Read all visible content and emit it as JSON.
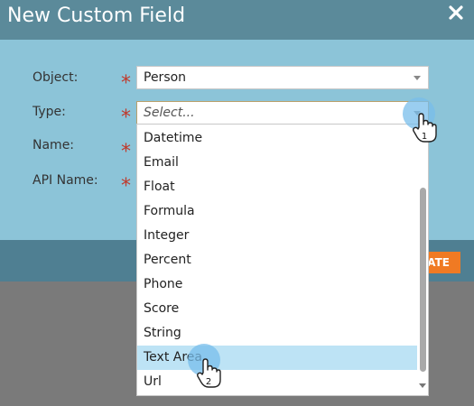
{
  "dialog": {
    "title": "New Custom Field",
    "create_button_label": "ATE"
  },
  "fields": {
    "object_label": "Object:",
    "type_label": "Type:",
    "name_label": "Name:",
    "api_name_label": "API Name:",
    "required_marker": "*",
    "object_value": "Person",
    "type_placeholder": "Select..."
  },
  "dropdown": {
    "options": [
      "Datetime",
      "Email",
      "Float",
      "Formula",
      "Integer",
      "Percent",
      "Phone",
      "Score",
      "String",
      "Text Area",
      "Url"
    ],
    "highlighted": "Text Area"
  },
  "annotations": {
    "step_1": "1",
    "step_2": "2"
  },
  "colors": {
    "title_bar": "#5b8a9a",
    "dialog_body": "#8cc4d8",
    "footer": "#4f7f92",
    "create_button": "#f07a23",
    "required": "#c0392b",
    "highlight": "#bde3f5"
  },
  "icons": {
    "close": "close-icon",
    "dropdown_caret": "chevron-down-icon",
    "cursor": "hand-pointer-icon"
  }
}
